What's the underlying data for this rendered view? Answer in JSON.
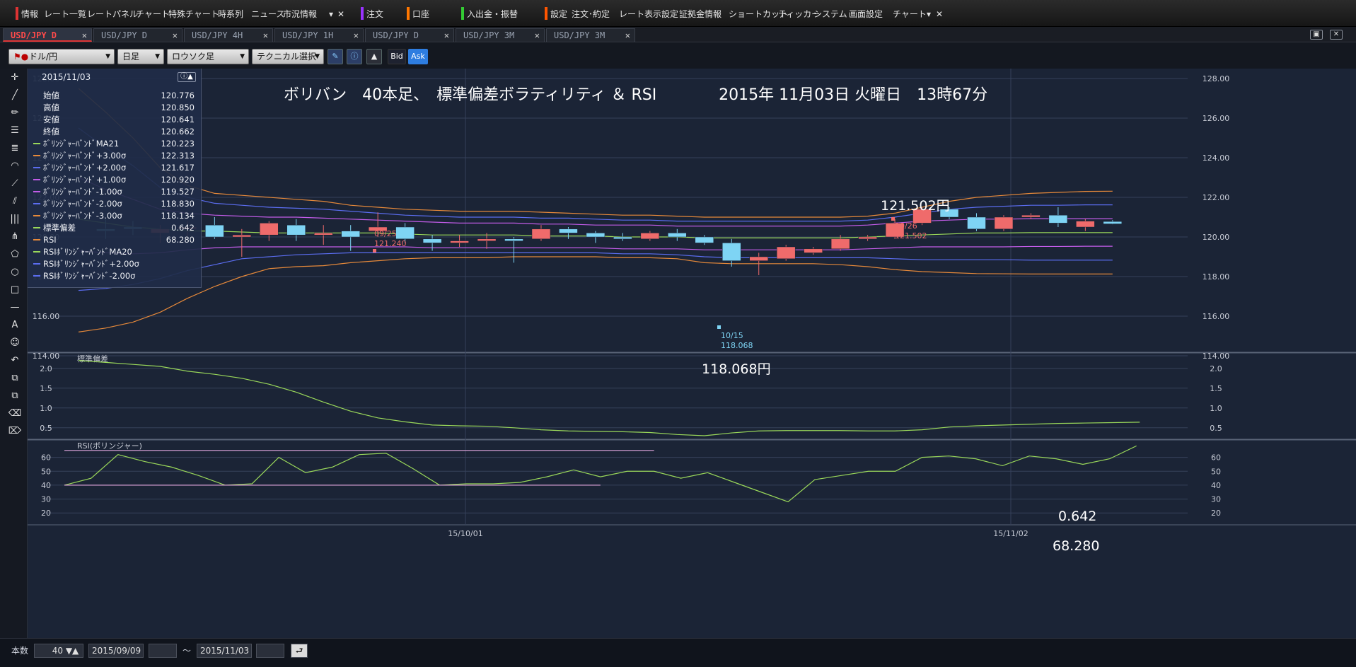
{
  "menubar": {
    "items": [
      {
        "label": "情報",
        "color": "#d33"
      },
      {
        "label": "レート一覧"
      },
      {
        "label": "レートパネル"
      },
      {
        "label": "チャート"
      },
      {
        "label": "特殊チャート"
      },
      {
        "label": "時系列"
      },
      {
        "label": "ニュース"
      },
      {
        "label": "市況情報"
      },
      {
        "label": "注文",
        "color": "#9933ff"
      },
      {
        "label": "口座",
        "color": "#ff7700"
      },
      {
        "label": "入出金・振替",
        "color": "#33cc33"
      },
      {
        "label": "設定",
        "color": "#ff5500"
      },
      {
        "label": "注文･約定"
      },
      {
        "label": "レート表示設定"
      },
      {
        "label": "証拠金情報"
      },
      {
        "label": "ショートカット"
      },
      {
        "label": "ティッカー"
      },
      {
        "label": "システム"
      },
      {
        "label": "画面設定"
      },
      {
        "label": "チャート"
      }
    ]
  },
  "tabs": [
    {
      "label": "USD/JPY D",
      "active": true
    },
    {
      "label": "USD/JPY D"
    },
    {
      "label": "USD/JPY 4H"
    },
    {
      "label": "USD/JPY 1H"
    },
    {
      "label": "USD/JPY D"
    },
    {
      "label": "USD/JPY 3M"
    },
    {
      "label": "USD/JPY 3M"
    }
  ],
  "toolbar": {
    "pair": "ドル/円",
    "period": "日足",
    "chart_type": "ロウソク足",
    "technical": "テクニカル選択",
    "bid": "Bid",
    "ask": "Ask"
  },
  "datapanel": {
    "date": "2015/11/03",
    "rows": [
      {
        "label": "始値",
        "value": "120.776",
        "color": ""
      },
      {
        "label": "高値",
        "value": "120.850",
        "color": ""
      },
      {
        "label": "安値",
        "value": "120.641",
        "color": ""
      },
      {
        "label": "終値",
        "value": "120.662",
        "color": ""
      },
      {
        "label": "ﾎﾞﾘﾝｼﾞｬｰﾊﾞﾝﾄﾞMA21",
        "value": "120.223",
        "color": "#9ad85a"
      },
      {
        "label": "ﾎﾞﾘﾝｼﾞｬｰﾊﾞﾝﾄﾞ+3.00σ",
        "value": "122.313",
        "color": "#e6893a"
      },
      {
        "label": "ﾎﾞﾘﾝｼﾞｬｰﾊﾞﾝﾄﾞ+2.00σ",
        "value": "121.617",
        "color": "#5b6df0"
      },
      {
        "label": "ﾎﾞﾘﾝｼﾞｬｰﾊﾞﾝﾄﾞ+1.00σ",
        "value": "120.920",
        "color": "#c25ce8"
      },
      {
        "label": "ﾎﾞﾘﾝｼﾞｬｰﾊﾞﾝﾄﾞ-1.00σ",
        "value": "119.527",
        "color": "#c25ce8"
      },
      {
        "label": "ﾎﾞﾘﾝｼﾞｬｰﾊﾞﾝﾄﾞ-2.00σ",
        "value": "118.830",
        "color": "#5b6df0"
      },
      {
        "label": "ﾎﾞﾘﾝｼﾞｬｰﾊﾞﾝﾄﾞ-3.00σ",
        "value": "118.134",
        "color": "#e6893a"
      },
      {
        "label": "標準偏差",
        "value": "0.642",
        "color": "#9ad85a"
      },
      {
        "label": "RSI",
        "value": "68.280",
        "color": "#e6893a"
      },
      {
        "label": "RSIﾎﾞﾘﾝｼﾞｬｰﾊﾞﾝﾄﾞMA20",
        "value": "",
        "color": "#9ad85a"
      },
      {
        "label": "RSIﾎﾞﾘﾝｼﾞｬｰﾊﾞﾝﾄﾞ+2.00σ",
        "value": "",
        "color": "#5b6df0"
      },
      {
        "label": "RSIﾎﾞﾘﾝｼﾞｬｰﾊﾞﾝﾄﾞ-2.00σ",
        "value": "",
        "color": "#5b6df0"
      }
    ]
  },
  "annotations": {
    "headline": "ボリバン　40本足、　標準偏差ボラティリティ ＆ RSI　　　　2015年 11月03日 火曜日　13時67分",
    "high_price": "121.502円",
    "low_price": "118.068円",
    "stddev_value": "0.642",
    "rsi_value": "68.280",
    "marker_high_1": {
      "date": "09/25",
      "value": "121.240"
    },
    "marker_high_2": {
      "date": "10/26",
      "value": "121.502"
    },
    "marker_low": {
      "date": "10/15",
      "value": "118.068"
    }
  },
  "bottombar": {
    "count_label": "本数",
    "count_value": "40",
    "from_date": "2015/09/09",
    "tilde": "〜",
    "to_date": "2015/11/03"
  },
  "chart_data": [
    {
      "type": "candlestick",
      "title": "",
      "ylim": [
        114,
        128
      ],
      "yticks": [
        "114.00",
        "116.00",
        "118.00",
        "120.00",
        "122.00",
        "124.00",
        "126.00",
        "128.00"
      ],
      "xticks": [
        "15/10/01",
        "15/11/02"
      ],
      "colors": {
        "up": "#ef6b6b",
        "down": "#7ed4f4"
      },
      "candles": [
        {
          "o": 120.4,
          "h": 120.9,
          "l": 119.9,
          "c": 120.3
        },
        {
          "o": 120.5,
          "h": 120.8,
          "l": 120.1,
          "c": 120.4
        },
        {
          "o": 120.2,
          "h": 120.6,
          "l": 119.7,
          "c": 120.4
        },
        {
          "o": 120.4,
          "h": 120.8,
          "l": 120.0,
          "c": 120.5
        },
        {
          "o": 120.6,
          "h": 121.0,
          "l": 119.9,
          "c": 120.0
        },
        {
          "o": 120.0,
          "h": 120.4,
          "l": 119.0,
          "c": 120.1
        },
        {
          "o": 120.1,
          "h": 120.8,
          "l": 119.8,
          "c": 120.7
        },
        {
          "o": 120.6,
          "h": 120.9,
          "l": 119.8,
          "c": 120.1
        },
        {
          "o": 120.1,
          "h": 120.6,
          "l": 119.6,
          "c": 120.2
        },
        {
          "o": 120.3,
          "h": 120.6,
          "l": 119.3,
          "c": 120.0
        },
        {
          "o": 120.3,
          "h": 121.24,
          "l": 120.0,
          "c": 120.5
        },
        {
          "o": 120.5,
          "h": 120.7,
          "l": 119.7,
          "c": 119.9
        },
        {
          "o": 119.9,
          "h": 120.1,
          "l": 119.3,
          "c": 119.7
        },
        {
          "o": 119.7,
          "h": 120.1,
          "l": 119.5,
          "c": 119.8
        },
        {
          "o": 119.8,
          "h": 120.2,
          "l": 119.4,
          "c": 119.9
        },
        {
          "o": 119.9,
          "h": 120.0,
          "l": 118.7,
          "c": 119.8
        },
        {
          "o": 119.9,
          "h": 120.6,
          "l": 119.8,
          "c": 120.4
        },
        {
          "o": 120.4,
          "h": 120.5,
          "l": 119.9,
          "c": 120.2
        },
        {
          "o": 120.2,
          "h": 120.3,
          "l": 119.7,
          "c": 120.0
        },
        {
          "o": 120.0,
          "h": 120.2,
          "l": 119.8,
          "c": 119.9
        },
        {
          "o": 119.9,
          "h": 120.3,
          "l": 119.8,
          "c": 120.2
        },
        {
          "o": 120.2,
          "h": 120.4,
          "l": 119.8,
          "c": 120.0
        },
        {
          "o": 120.0,
          "h": 120.1,
          "l": 119.6,
          "c": 119.7
        },
        {
          "o": 119.7,
          "h": 119.9,
          "l": 118.5,
          "c": 118.8
        },
        {
          "o": 118.8,
          "h": 119.2,
          "l": 118.07,
          "c": 119.0
        },
        {
          "o": 118.9,
          "h": 119.6,
          "l": 118.8,
          "c": 119.5
        },
        {
          "o": 119.2,
          "h": 119.5,
          "l": 119.1,
          "c": 119.4
        },
        {
          "o": 119.4,
          "h": 120.1,
          "l": 119.3,
          "c": 119.9
        },
        {
          "o": 119.9,
          "h": 120.1,
          "l": 119.8,
          "c": 120.0
        },
        {
          "o": 120.0,
          "h": 120.9,
          "l": 119.9,
          "c": 120.7
        },
        {
          "o": 120.7,
          "h": 121.5,
          "l": 120.6,
          "c": 121.4
        },
        {
          "o": 121.4,
          "h": 121.5,
          "l": 120.9,
          "c": 121.0
        },
        {
          "o": 121.0,
          "h": 121.2,
          "l": 120.3,
          "c": 120.4
        },
        {
          "o": 120.4,
          "h": 121.1,
          "l": 120.3,
          "c": 121.0
        },
        {
          "o": 121.0,
          "h": 121.2,
          "l": 120.9,
          "c": 121.1
        },
        {
          "o": 121.1,
          "h": 121.5,
          "l": 120.5,
          "c": 120.7
        },
        {
          "o": 120.5,
          "h": 120.9,
          "l": 120.3,
          "c": 120.8
        },
        {
          "o": 120.78,
          "h": 120.85,
          "l": 120.64,
          "c": 120.66
        }
      ],
      "series": [
        {
          "name": "ﾎﾞﾘﾝｼﾞｬｰﾊﾞﾝﾄﾞ+3.00σ",
          "color": "#e6893a",
          "values": [
            127.5,
            126.3,
            125.0,
            123.5,
            122.6,
            122.2,
            122.1,
            122.0,
            121.9,
            121.8,
            121.6,
            121.5,
            121.4,
            121.35,
            121.3,
            121.3,
            121.3,
            121.25,
            121.2,
            121.15,
            121.1,
            121.1,
            121.05,
            121.0,
            121.0,
            121.0,
            121.0,
            121.0,
            121.0,
            121.05,
            121.2,
            121.5,
            121.8,
            122.0,
            122.1,
            122.2,
            122.25,
            122.3,
            122.31
          ]
        },
        {
          "name": "ﾎﾞﾘﾝｼﾞｬｰﾊﾞﾝﾄﾞ+2.00σ",
          "color": "#5b6df0",
          "values": [
            125.5,
            124.5,
            123.6,
            122.5,
            122.0,
            121.7,
            121.6,
            121.5,
            121.45,
            121.4,
            121.3,
            121.2,
            121.1,
            121.05,
            121.0,
            121.0,
            121.0,
            120.95,
            120.95,
            120.9,
            120.85,
            120.85,
            120.8,
            120.8,
            120.8,
            120.8,
            120.8,
            120.8,
            120.8,
            120.85,
            121.0,
            121.2,
            121.4,
            121.5,
            121.55,
            121.6,
            121.6,
            121.62,
            121.62
          ]
        },
        {
          "name": "ﾎﾞﾘﾝｼﾞｬｰﾊﾞﾝﾄﾞ+1.00σ",
          "color": "#c25ce8",
          "values": [
            123.0,
            122.4,
            121.9,
            121.4,
            121.2,
            121.1,
            121.05,
            121.0,
            121.0,
            120.95,
            120.9,
            120.85,
            120.8,
            120.75,
            120.7,
            120.7,
            120.7,
            120.65,
            120.65,
            120.6,
            120.6,
            120.6,
            120.55,
            120.55,
            120.55,
            120.55,
            120.55,
            120.55,
            120.55,
            120.6,
            120.7,
            120.8,
            120.85,
            120.9,
            120.9,
            120.92,
            120.92,
            120.92,
            120.92
          ]
        },
        {
          "name": "ﾎﾞﾘﾝｼﾞｬｰﾊﾞﾝﾄﾞMA21",
          "color": "#9ad85a",
          "values": [
            120.9,
            120.7,
            120.5,
            120.4,
            120.3,
            120.3,
            120.25,
            120.2,
            120.2,
            120.2,
            120.2,
            120.2,
            120.15,
            120.1,
            120.1,
            120.1,
            120.1,
            120.05,
            120.05,
            120.05,
            120.0,
            120.0,
            120.0,
            119.95,
            119.95,
            119.95,
            119.95,
            119.95,
            119.95,
            120.0,
            120.05,
            120.1,
            120.15,
            120.2,
            120.2,
            120.22,
            120.22,
            120.22,
            120.22
          ]
        },
        {
          "name": "ﾎﾞﾘﾝｼﾞｬｰﾊﾞﾝﾄﾞ-1.00σ",
          "color": "#c25ce8",
          "values": [
            119.3,
            119.2,
            119.15,
            119.2,
            119.35,
            119.45,
            119.5,
            119.5,
            119.5,
            119.5,
            119.5,
            119.5,
            119.5,
            119.45,
            119.45,
            119.45,
            119.45,
            119.45,
            119.45,
            119.45,
            119.4,
            119.4,
            119.4,
            119.35,
            119.35,
            119.35,
            119.35,
            119.35,
            119.35,
            119.4,
            119.45,
            119.5,
            119.5,
            119.5,
            119.5,
            119.52,
            119.52,
            119.53,
            119.53
          ]
        },
        {
          "name": "ﾎﾞﾘﾝｼﾞｬｰﾊﾞﾝﾄﾞ-2.00σ",
          "color": "#5b6df0",
          "values": [
            117.3,
            117.4,
            117.6,
            117.9,
            118.3,
            118.6,
            118.9,
            119.0,
            119.1,
            119.15,
            119.2,
            119.2,
            119.2,
            119.2,
            119.2,
            119.2,
            119.2,
            119.2,
            119.2,
            119.2,
            119.15,
            119.15,
            119.1,
            119.0,
            118.95,
            118.95,
            118.95,
            118.95,
            118.95,
            118.95,
            118.9,
            118.85,
            118.85,
            118.85,
            118.85,
            118.83,
            118.83,
            118.83,
            118.83
          ]
        },
        {
          "name": "ﾎﾞﾘﾝｼﾞｬｰﾊﾞﾝﾄﾞ-3.00σ",
          "color": "#e6893a",
          "values": [
            115.2,
            115.4,
            115.7,
            116.2,
            116.9,
            117.5,
            118.0,
            118.4,
            118.5,
            118.55,
            118.7,
            118.8,
            118.9,
            118.95,
            118.95,
            118.95,
            119.0,
            119.0,
            119.0,
            119.0,
            118.95,
            118.95,
            118.9,
            118.7,
            118.65,
            118.65,
            118.65,
            118.65,
            118.6,
            118.5,
            118.35,
            118.25,
            118.2,
            118.15,
            118.14,
            118.13,
            118.13,
            118.13,
            118.13
          ]
        }
      ]
    },
    {
      "type": "line",
      "title": "標準偏差",
      "ylim": [
        0.3,
        2.3
      ],
      "yticks": [
        "0.5",
        "1.0",
        "1.5",
        "2.0"
      ],
      "series": [
        {
          "name": "標準偏差",
          "color": "#9ad85a",
          "values": [
            2.2,
            2.15,
            2.1,
            2.05,
            1.93,
            1.85,
            1.75,
            1.6,
            1.4,
            1.15,
            0.92,
            0.75,
            0.65,
            0.57,
            0.55,
            0.54,
            0.5,
            0.45,
            0.42,
            0.41,
            0.4,
            0.38,
            0.33,
            0.3,
            0.37,
            0.42,
            0.43,
            0.43,
            0.43,
            0.42,
            0.42,
            0.45,
            0.52,
            0.55,
            0.57,
            0.59,
            0.61,
            0.62,
            0.63,
            0.642
          ]
        }
      ]
    },
    {
      "type": "line",
      "title": "RSI(ボリンジャー)",
      "ylim": [
        14,
        70
      ],
      "yticks": [
        "20",
        "30",
        "40",
        "50",
        "60"
      ],
      "series": [
        {
          "name": "RSI",
          "color": "#9ad85a",
          "values": [
            40,
            45,
            62,
            57,
            53,
            47,
            40,
            41,
            60,
            49,
            53,
            62,
            63,
            52,
            40,
            41,
            41,
            42,
            46,
            51,
            46,
            50,
            50,
            45,
            49,
            42,
            35,
            28,
            44,
            47,
            50,
            50,
            60,
            61,
            59,
            54,
            61,
            59,
            55,
            59,
            68.28
          ]
        },
        {
          "name": "RSIﾎﾞﾘﾝｼﾞｬｰﾊﾞﾝﾄﾞ+2.00σ",
          "color": "#e6a8e0",
          "values": [
            65,
            65,
            65,
            65,
            65,
            65,
            65,
            65,
            65,
            65,
            65,
            65,
            65,
            65,
            65,
            65,
            65,
            65,
            65,
            65,
            65,
            65,
            65
          ]
        },
        {
          "name": "RSIﾎﾞﾘﾝｼﾞｬｰﾊﾞﾝﾄﾞ-2.00σ",
          "color": "#e6a8e0",
          "values": [
            40,
            40,
            40,
            40,
            40,
            40,
            40,
            40,
            40,
            40,
            40,
            40,
            40,
            40,
            40,
            40,
            40,
            40,
            40,
            40,
            40
          ]
        }
      ]
    }
  ]
}
